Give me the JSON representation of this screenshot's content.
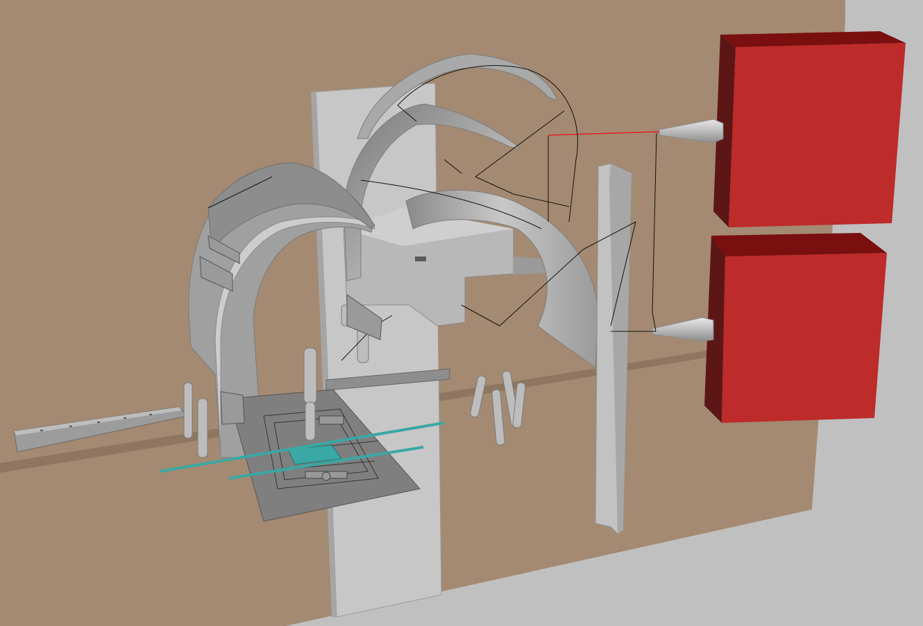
{
  "scene": {
    "background_color": "#c0c0c0",
    "wall_color": "#a48a72",
    "wall_shadow_color": "#8f7660",
    "metal_light": "#c4c4c4",
    "metal_mid": "#a6a6a6",
    "metal_dark": "#7e7e7e",
    "box_front_color": "#bd2b2b",
    "box_top_color": "#7a0f0f",
    "box_side_color": "#5c1616",
    "glass_color": "#3aa8a4",
    "beam_line_color": "#e02020",
    "wire_color": "#111111"
  },
  "objects": {
    "back_wall": "wall-panel",
    "mount_column": "vertical-column",
    "arches": [
      "front-arch",
      "upper-arch",
      "rear-arch"
    ],
    "emitter_boxes": [
      "red-box-top",
      "red-box-bottom"
    ],
    "emitter_cones": [
      "cone-top",
      "cone-bottom"
    ],
    "rails": [
      "left-rail",
      "center-rail"
    ],
    "sample_stage": "sample-stage",
    "angle_post": "angle-post"
  }
}
